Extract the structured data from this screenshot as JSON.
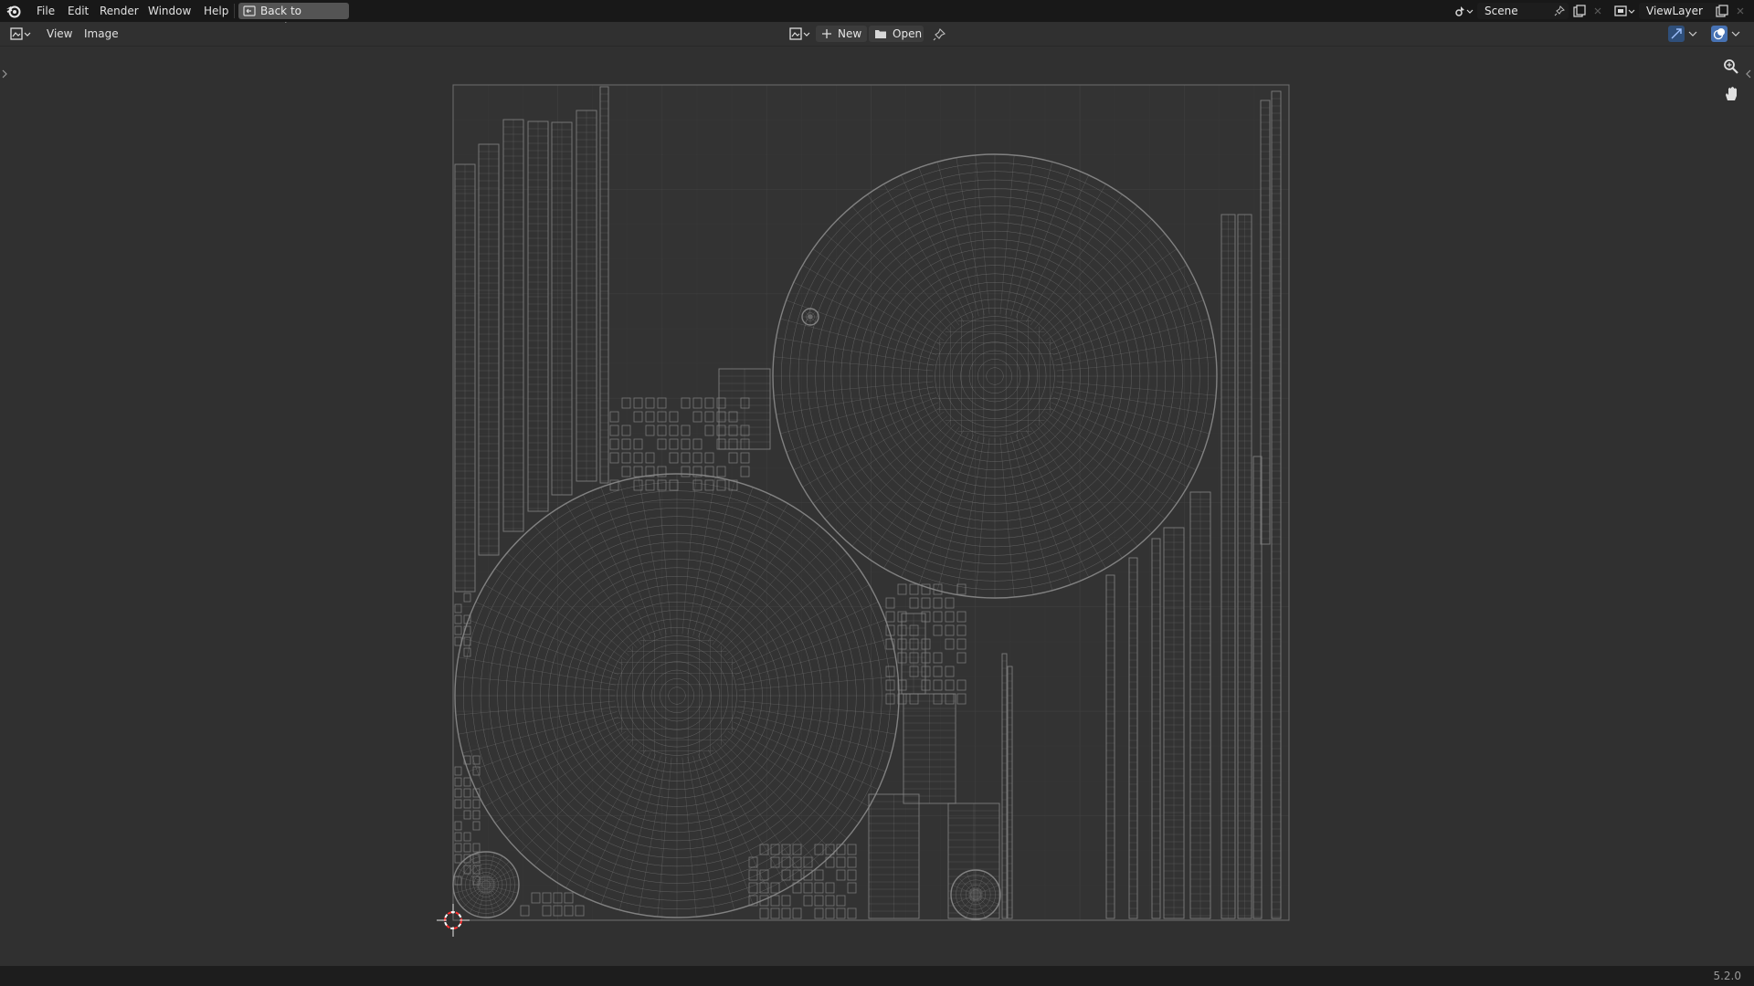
{
  "menu": {
    "file": "File",
    "edit": "Edit",
    "render": "Render",
    "window": "Window",
    "help": "Help",
    "back_to_previous": "Back to Previous"
  },
  "scene": {
    "name": "Scene"
  },
  "view_layer": {
    "name": "ViewLayer"
  },
  "editor_header": {
    "view": "View",
    "image": "Image",
    "new": "New",
    "open": "Open"
  },
  "status": {
    "version": "5.2.0"
  },
  "colors": {
    "topbar": "#181818",
    "editor_background": "#303030",
    "uv_wire": "#8a8a8a",
    "uv_area_outline": "#6e6e6e",
    "cursor_red": "#ff3030",
    "active_toggle": "#4772b3"
  },
  "icons": {
    "logo": "blender-logo-icon",
    "back": "back-to-previous-icon",
    "scene": "scene-icon",
    "pin": "pin-icon",
    "new_scene": "new-scene-icon",
    "view_layer": "view-layer-icon",
    "editor_type": "image-editor-icon",
    "image_browse": "image-browse-icon",
    "new": "plus-icon",
    "open": "folder-icon",
    "gizmo": "gizmo-toggle-icon",
    "overlay": "overlay-icon",
    "zoom": "zoom-icon",
    "pan": "hand-pan-icon",
    "cursor": "2d-cursor-icon"
  }
}
